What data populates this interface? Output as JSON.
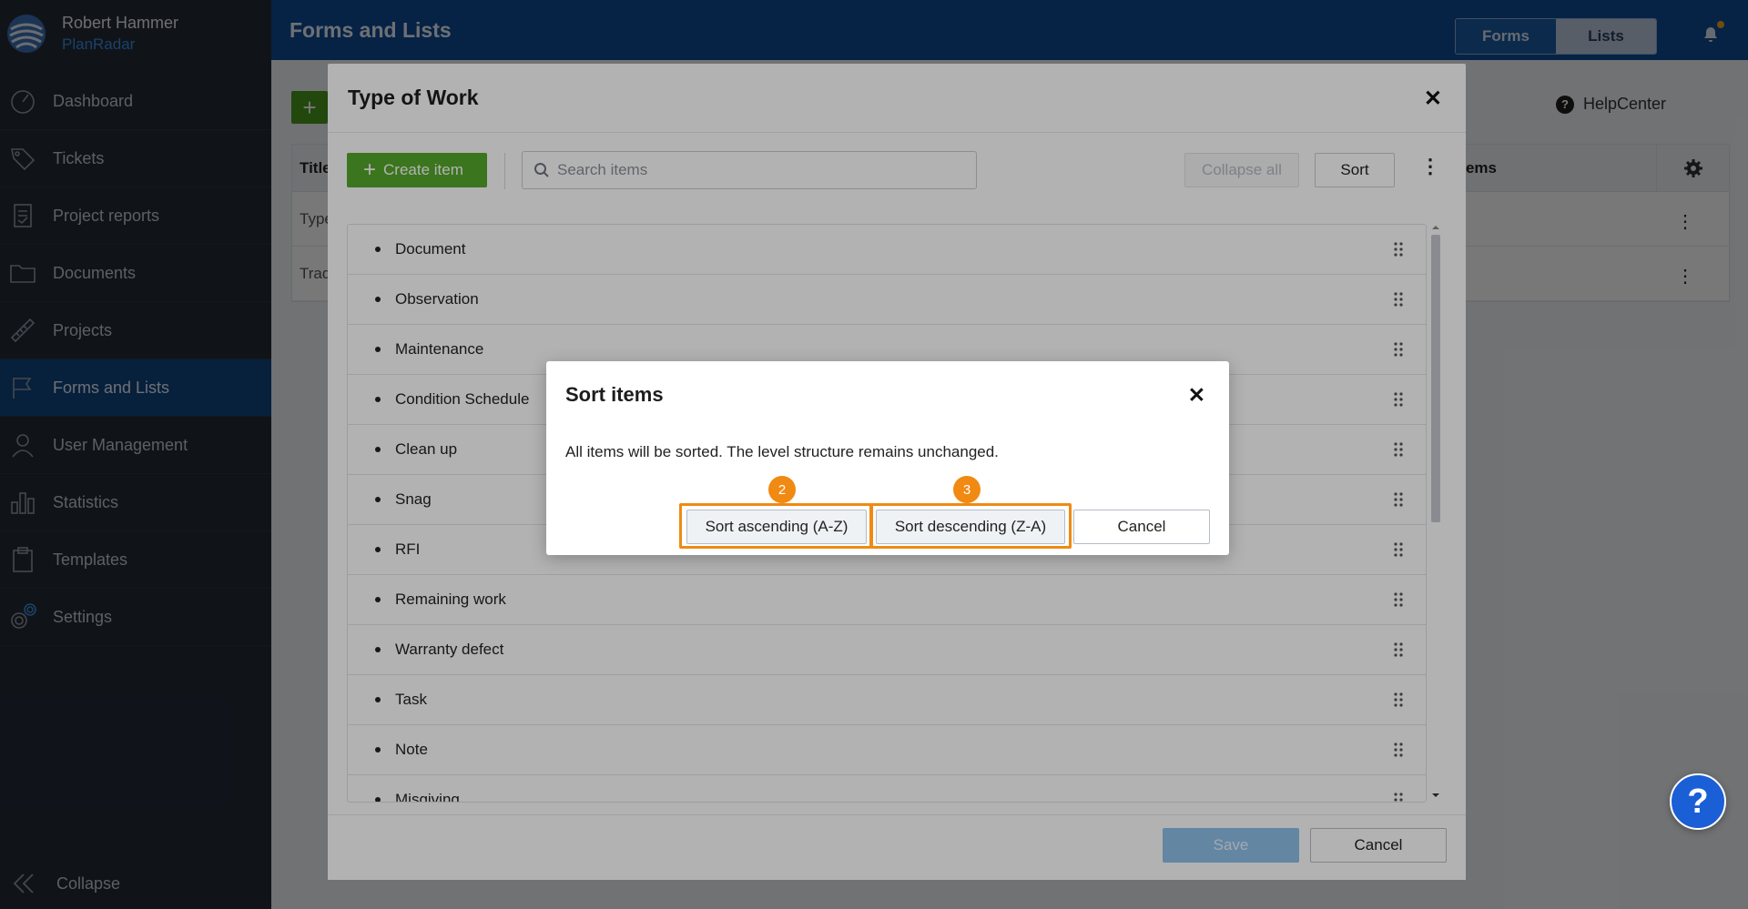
{
  "user": {
    "name": "Robert Hammer",
    "company": "PlanRadar"
  },
  "sidebar": {
    "items": [
      {
        "label": "Dashboard",
        "icon": "dashboard-icon",
        "active": false
      },
      {
        "label": "Tickets",
        "icon": "ticket-icon",
        "active": false
      },
      {
        "label": "Project reports",
        "icon": "report-icon",
        "active": false
      },
      {
        "label": "Documents",
        "icon": "folder-icon",
        "active": false
      },
      {
        "label": "Projects",
        "icon": "ruler-icon",
        "active": false
      },
      {
        "label": "Forms and Lists",
        "icon": "flag-icon",
        "active": true
      },
      {
        "label": "User Management",
        "icon": "user-icon",
        "active": false
      },
      {
        "label": "Statistics",
        "icon": "bar-chart-icon",
        "active": false
      },
      {
        "label": "Templates",
        "icon": "clipboard-icon",
        "active": false
      },
      {
        "label": "Settings",
        "icon": "gear-icon",
        "active": false
      }
    ],
    "collapse_label": "Collapse"
  },
  "header": {
    "title": "Forms and Lists",
    "tabs": [
      {
        "label": "Forms",
        "active": true
      },
      {
        "label": "Lists",
        "active": false
      }
    ]
  },
  "background": {
    "helpcenter_label": "HelpCenter",
    "table": {
      "col_title": "Title",
      "col_items": "Items",
      "rows": [
        {
          "title": "Type"
        },
        {
          "title": "Trad"
        }
      ]
    }
  },
  "modal": {
    "title": "Type of Work",
    "create_label": "Create item",
    "search_placeholder": "Search items",
    "collapse_all_label": "Collapse all",
    "sort_label": "Sort",
    "items": [
      "Document",
      "Observation",
      "Maintenance",
      "Condition Schedule",
      "Clean up",
      "Snag",
      "RFI",
      "Remaining work",
      "Warranty defect",
      "Task",
      "Note",
      "Misgiving"
    ],
    "save_label": "Save",
    "cancel_label": "Cancel"
  },
  "dialog": {
    "title": "Sort items",
    "description": "All items will be sorted. The level structure remains unchanged.",
    "asc_label": "Sort ascending (A-Z)",
    "desc_label": "Sort descending (Z-A)",
    "cancel_label": "Cancel",
    "badges": [
      "2",
      "3"
    ]
  },
  "colors": {
    "accent": "#0f4c94",
    "highlight": "#f08a12",
    "create": "#55a82c"
  }
}
